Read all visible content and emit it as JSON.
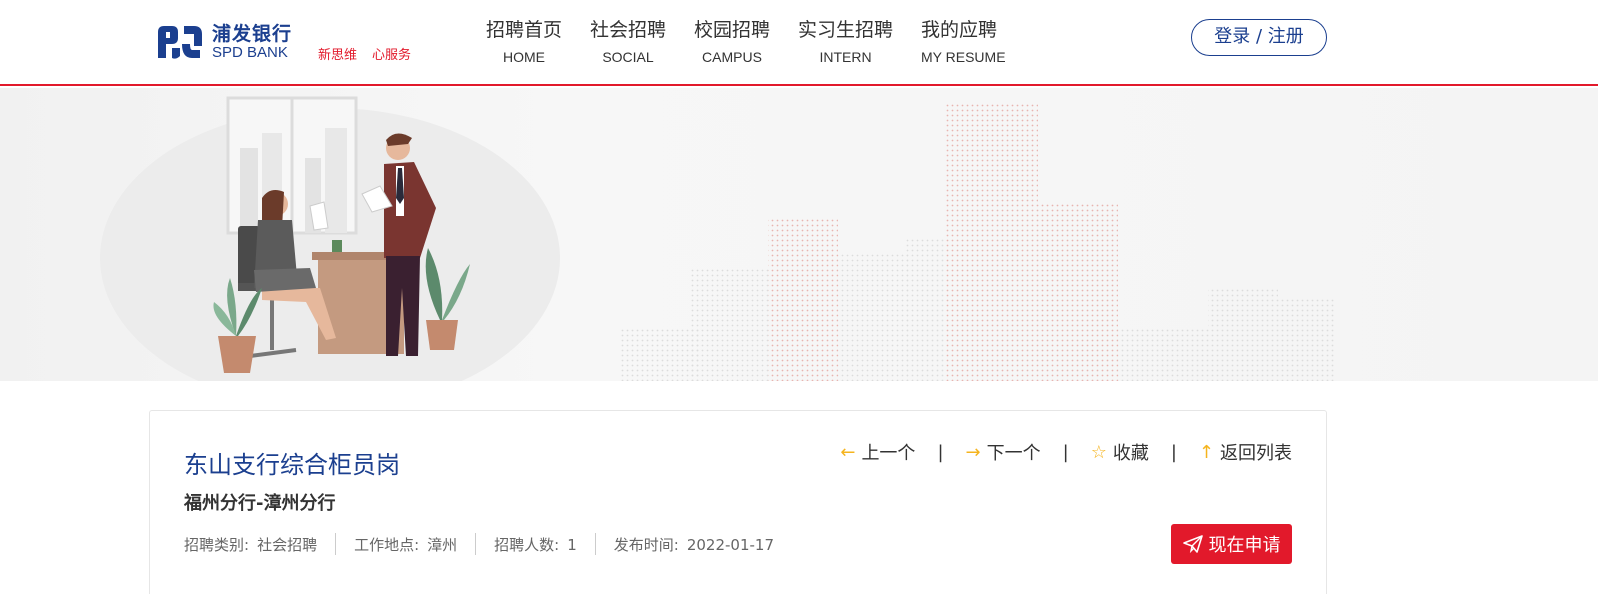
{
  "brand": {
    "name_cn": "浦发银行",
    "name_en": "SPD BANK",
    "slogan_1": "新思维",
    "slogan_2": "心服务",
    "brand_color": "#1b3f8f",
    "accent_color": "#e2192b"
  },
  "nav": [
    {
      "cn": "招聘首页",
      "en": "HOME"
    },
    {
      "cn": "社会招聘",
      "en": "SOCIAL"
    },
    {
      "cn": "校园招聘",
      "en": "CAMPUS"
    },
    {
      "cn": "实习生招聘",
      "en": "INTERN"
    },
    {
      "cn": "我的应聘",
      "en": "MY RESUME"
    }
  ],
  "login_label": "登录 / 注册",
  "job": {
    "title": "东山支行综合柜员岗",
    "branch": "福州分行-漳州分行",
    "actions": {
      "prev": "上一个",
      "next": "下一个",
      "favorite": "收藏",
      "back": "返回列表",
      "separator": "|"
    },
    "meta": {
      "category_label": "招聘类别:",
      "category_value": "社会招聘",
      "location_label": "工作地点:",
      "location_value": "漳州",
      "count_label": "招聘人数:",
      "count_value": "1",
      "date_label": "发布时间:",
      "date_value": "2022-01-17"
    },
    "apply_label": "现在申请"
  },
  "icons": {
    "prev": "arrow-left-icon",
    "next": "arrow-right-icon",
    "favorite": "star-icon",
    "back": "arrow-up-icon",
    "apply": "paper-plane-icon"
  }
}
